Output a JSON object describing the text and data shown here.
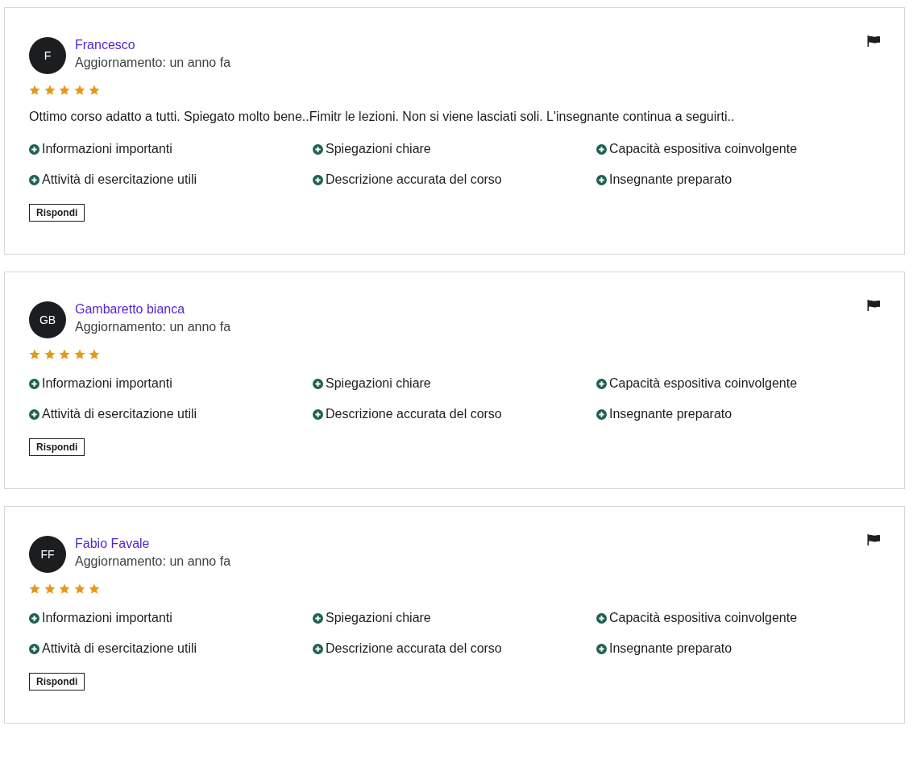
{
  "reviews": [
    {
      "initials": "F",
      "name": "Francesco",
      "updated": "Aggiornamento: un anno fa",
      "stars": 5,
      "comment": "Ottimo corso adatto a tutti. Spiegato molto bene..Fimitr le lezioni. Non si viene lasciati soli. L'insegnante continua a seguirti..",
      "tags": [
        "Informazioni importanti",
        "Spiegazioni chiare",
        "Capacità espositiva coinvolgente",
        "Attività di esercitazione utili",
        "Descrizione accurata del corso",
        "Insegnante preparato"
      ],
      "reply_button": "Rispondi"
    },
    {
      "initials": "GB",
      "name": "Gambaretto bianca",
      "updated": "Aggiornamento: un anno fa",
      "stars": 5,
      "tags": [
        "Informazioni importanti",
        "Spiegazioni chiare",
        "Capacità espositiva coinvolgente",
        "Attività di esercitazione utili",
        "Descrizione accurata del corso",
        "Insegnante preparato"
      ],
      "reply_button": "Rispondi"
    },
    {
      "initials": "FF",
      "name": "Fabio Favale",
      "updated": "Aggiornamento: un anno fa",
      "stars": 5,
      "tags": [
        "Informazioni importanti",
        "Spiegazioni chiare",
        "Capacità espositiva coinvolgente",
        "Attività di esercitazione utili",
        "Descrizione accurata del corso",
        "Insegnante preparato"
      ],
      "reply_button": "Rispondi"
    }
  ]
}
